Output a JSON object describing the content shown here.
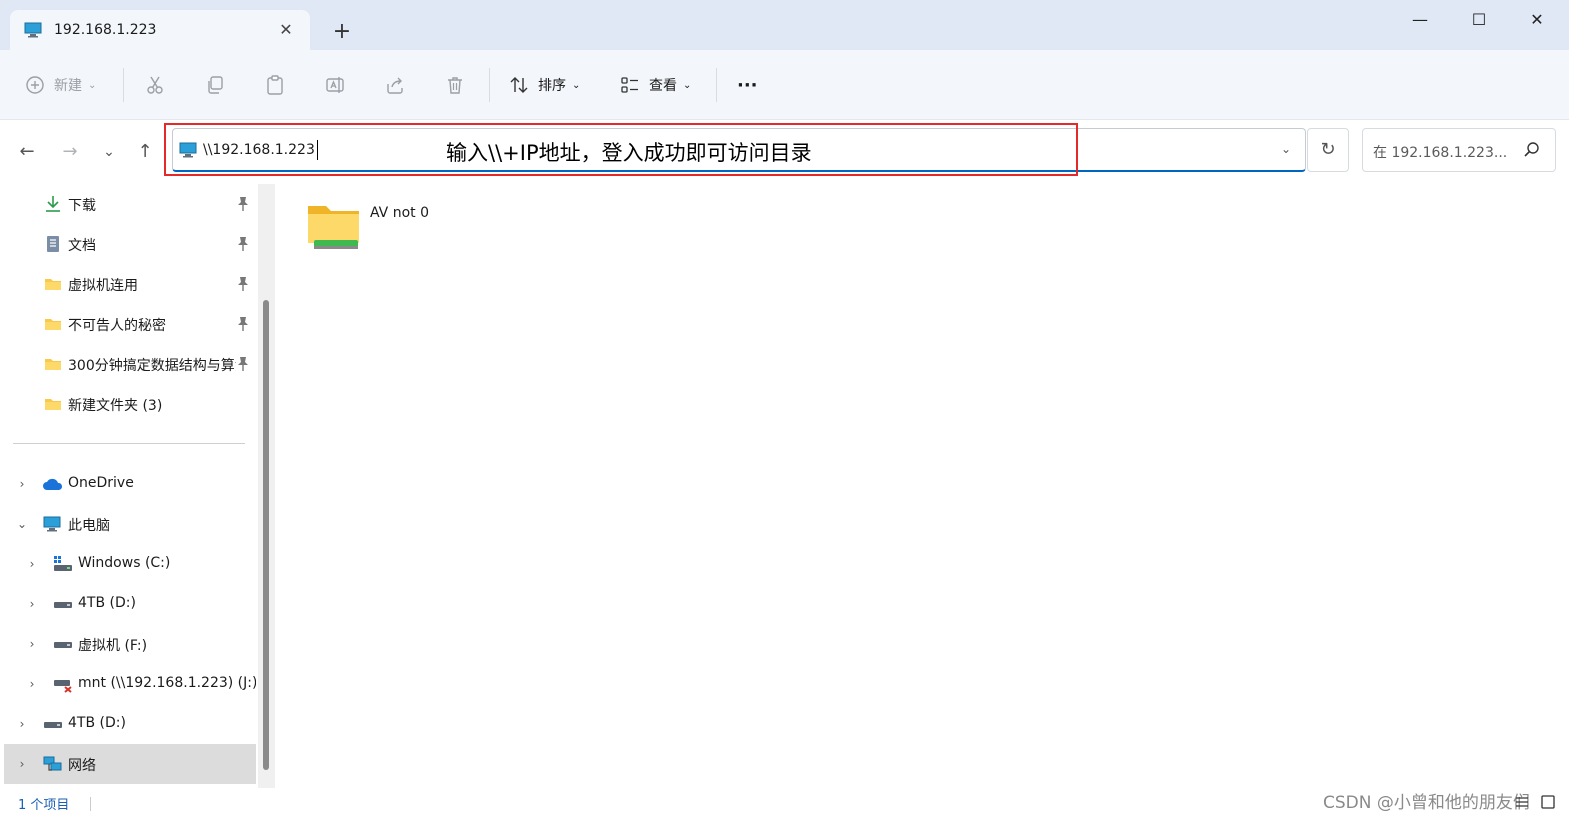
{
  "tab": {
    "title": "192.168.1.223",
    "close": "✕",
    "new_tab": "+"
  },
  "window": {
    "minimize": "—",
    "maximize": "☐",
    "close": "✕"
  },
  "toolbar": {
    "new_label": "新建",
    "sort_label": "排序",
    "view_label": "查看",
    "more_label": "···"
  },
  "address": {
    "path": "\\\\192.168.1.223",
    "annotation": "输入\\\\+IP地址，登入成功即可访问目录",
    "search_placeholder": "在 192.168.1.223..."
  },
  "sidebar": {
    "quick_access": [
      {
        "label": "下载",
        "icon": "download-icon",
        "pinned": true
      },
      {
        "label": "文档",
        "icon": "document-icon",
        "pinned": true
      },
      {
        "label": "虚拟机连用",
        "icon": "folder-icon",
        "pinned": true
      },
      {
        "label": "不可告人的秘密",
        "icon": "folder-icon",
        "pinned": true
      },
      {
        "label": "300分钟搞定数据结构与算法",
        "icon": "folder-icon",
        "pinned": true
      },
      {
        "label": "新建文件夹 (3)",
        "icon": "folder-icon",
        "pinned": false
      }
    ],
    "tree": [
      {
        "label": "OneDrive",
        "icon": "cloud-icon",
        "expanded": false,
        "level": 0
      },
      {
        "label": "此电脑",
        "icon": "computer-icon",
        "expanded": true,
        "level": 0
      },
      {
        "label": "Windows (C:)",
        "icon": "windows-drive-icon",
        "expanded": false,
        "level": 1
      },
      {
        "label": "4TB (D:)",
        "icon": "drive-icon",
        "expanded": false,
        "level": 1
      },
      {
        "label": "虚拟机 (F:)",
        "icon": "drive-icon",
        "expanded": false,
        "level": 1
      },
      {
        "label": "mnt (\\\\192.168.1.223) (J:)",
        "icon": "network-drive-disconnected-icon",
        "expanded": false,
        "level": 1
      },
      {
        "label": "4TB (D:)",
        "icon": "drive-icon",
        "expanded": false,
        "level": 0
      },
      {
        "label": "网络",
        "icon": "network-icon",
        "expanded": false,
        "level": 0,
        "selected": true
      }
    ]
  },
  "content": {
    "items": [
      {
        "name": "AV not 0",
        "icon": "shared-folder-icon"
      }
    ]
  },
  "status": {
    "count": "1 个项目",
    "watermark": "CSDN @小曾和他的朋友们"
  },
  "colors": {
    "accent": "#0067c0",
    "annotation_border": "#e32929",
    "folder": "#f8c94a",
    "selected": "#dcdcdc"
  }
}
